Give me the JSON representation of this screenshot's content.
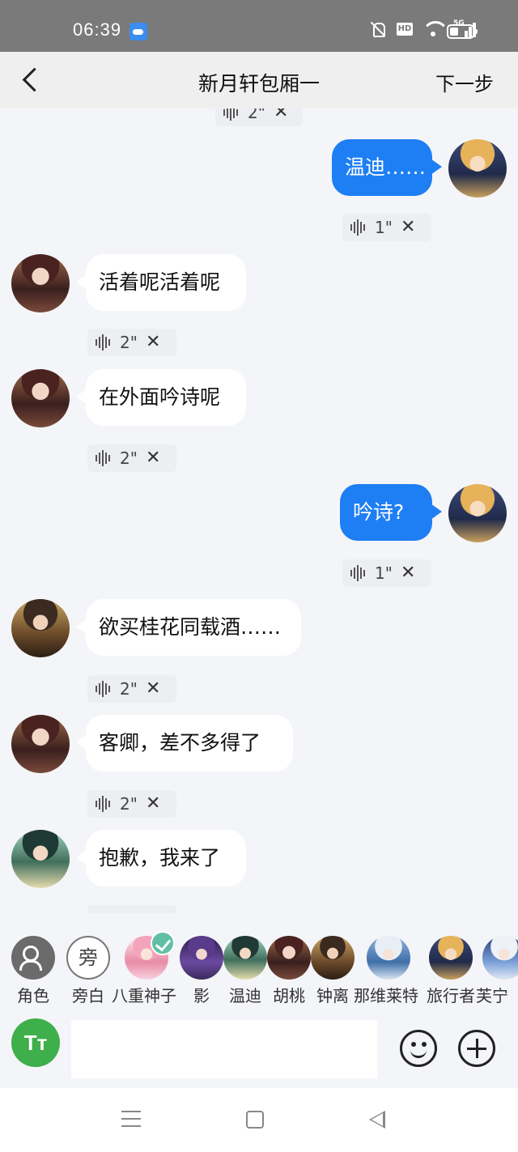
{
  "status_bar": {
    "time": "06:39",
    "hd_label": "HD",
    "network": "5G",
    "icons": [
      "weather-icon",
      "mute-icon",
      "wifi-icon",
      "signal-icon",
      "battery-icon"
    ]
  },
  "header": {
    "title": "新月轩包厢一",
    "next_label": "下一步",
    "back_icon": "chevron-left-icon"
  },
  "messages": [
    {
      "side": "right",
      "speaker": "旅行者",
      "text": "温迪……",
      "duration": "1\""
    },
    {
      "side": "left",
      "speaker": "胡桃",
      "text": "活着呢活着呢",
      "duration": "2\""
    },
    {
      "side": "left",
      "speaker": "胡桃",
      "text": "在外面吟诗呢",
      "duration": "2\""
    },
    {
      "side": "right",
      "speaker": "旅行者",
      "text": "吟诗?",
      "duration": "1\""
    },
    {
      "side": "left",
      "speaker": "钟离",
      "text": "欲买桂花同载酒……",
      "duration": "2\""
    },
    {
      "side": "left",
      "speaker": "胡桃",
      "text": "客卿，差不多得了",
      "duration": "2\""
    },
    {
      "side": "left",
      "speaker": "温迪",
      "text": "抱歉，我来了",
      "duration": ""
    }
  ],
  "partial_top_chip": {
    "duration": "2\""
  },
  "characters": [
    {
      "name": "角色",
      "icon": "role-settings-icon"
    },
    {
      "name": "旁白",
      "icon": "narrator-icon",
      "glyph": "旁"
    },
    {
      "name": "八重神子",
      "selected": true
    },
    {
      "name": "影"
    },
    {
      "name": "温迪"
    },
    {
      "name": "胡桃"
    },
    {
      "name": "钟离"
    },
    {
      "name": "那维莱特"
    },
    {
      "name": "旅行者"
    },
    {
      "name": "芙宁"
    }
  ],
  "input_bar": {
    "text_style_label": "Tт",
    "placeholder": ""
  },
  "colors": {
    "self_bubble": "#1e7ef4",
    "other_bubble": "#ffffff",
    "text_style_button": "#3eaf4a",
    "selected_badge": "#5fbfa5"
  }
}
